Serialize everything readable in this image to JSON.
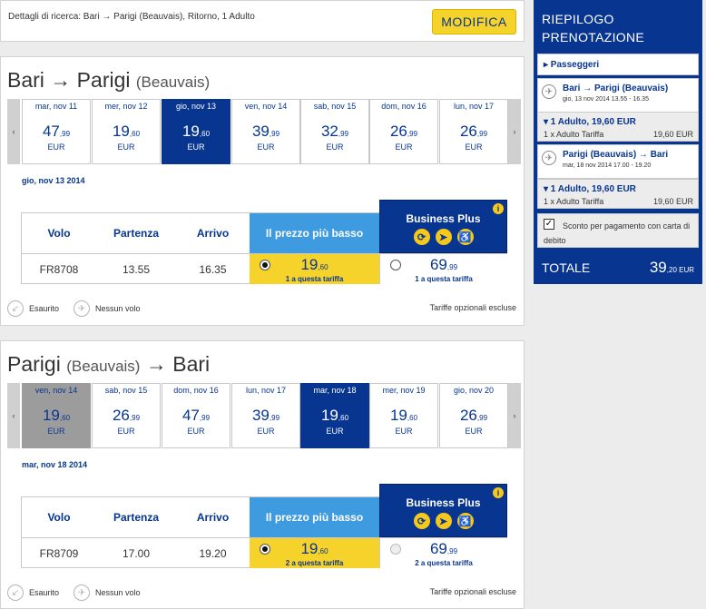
{
  "search": {
    "details": "Dettagli di ricerca: Bari → Parigi (Beauvais), Ritorno, 1 Adulto",
    "modify_label": "MODIFICA"
  },
  "legs": [
    {
      "title_main": "Bari → Parigi",
      "title_paren": "(Beauvais)",
      "days": [
        {
          "label": "mar, nov 11",
          "int": "47",
          "cents": ",99",
          "cur": "EUR",
          "state": "normal"
        },
        {
          "label": "mer, nov 12",
          "int": "19",
          "cents": ",60",
          "cur": "EUR",
          "state": "normal"
        },
        {
          "label": "gio, nov 13",
          "int": "19",
          "cents": ",60",
          "cur": "EUR",
          "state": "selected"
        },
        {
          "label": "ven, nov 14",
          "int": "39",
          "cents": ",99",
          "cur": "EUR",
          "state": "normal"
        },
        {
          "label": "sab, nov 15",
          "int": "32",
          "cents": ",99",
          "cur": "EUR",
          "state": "normal"
        },
        {
          "label": "dom, nov 16",
          "int": "26",
          "cents": ",99",
          "cur": "EUR",
          "state": "normal"
        },
        {
          "label": "lun, nov 17",
          "int": "26",
          "cents": ",99",
          "cur": "EUR",
          "state": "normal"
        }
      ],
      "date_heading": "gio, nov 13 2014",
      "headers": {
        "volo": "Volo",
        "partenza": "Partenza",
        "arrivo": "Arrivo",
        "lowest": "Il prezzo più basso",
        "business": "Business Plus"
      },
      "flight": {
        "number": "FR8708",
        "dep": "13.55",
        "arr": "16.35",
        "low_int": "19",
        "low_cents": ",60",
        "low_seats": "1 a questa tariffa",
        "biz_int": "69",
        "biz_cents": ",99",
        "biz_seats": "1 a questa tariffa",
        "low_selected": true
      }
    },
    {
      "title_main": "Parigi",
      "title_paren": "(Beauvais)",
      "title_tail": "→ Bari",
      "days": [
        {
          "label": "ven, nov 14",
          "int": "19",
          "cents": ",60",
          "cur": "EUR",
          "state": "grey"
        },
        {
          "label": "sab, nov 15",
          "int": "26",
          "cents": ",99",
          "cur": "EUR",
          "state": "normal"
        },
        {
          "label": "dom, nov 16",
          "int": "47",
          "cents": ",99",
          "cur": "EUR",
          "state": "normal"
        },
        {
          "label": "lun, nov 17",
          "int": "39",
          "cents": ",99",
          "cur": "EUR",
          "state": "normal"
        },
        {
          "label": "mar, nov 18",
          "int": "19",
          "cents": ",60",
          "cur": "EUR",
          "state": "selected"
        },
        {
          "label": "mer, nov 19",
          "int": "19",
          "cents": ",60",
          "cur": "EUR",
          "state": "normal"
        },
        {
          "label": "gio, nov 20",
          "int": "26",
          "cents": ",99",
          "cur": "EUR",
          "state": "normal"
        }
      ],
      "date_heading": "mar, nov 18 2014",
      "headers": {
        "volo": "Volo",
        "partenza": "Partenza",
        "arrivo": "Arrivo",
        "lowest": "Il prezzo più basso",
        "business": "Business Plus"
      },
      "flight": {
        "number": "FR8709",
        "dep": "17.00",
        "arr": "19.20",
        "low_int": "19",
        "low_cents": ",60",
        "low_seats": "2 a questa tariffa",
        "biz_int": "69",
        "biz_cents": ",99",
        "biz_seats": "2 a questa tariffa",
        "low_selected": true
      }
    }
  ],
  "legend": {
    "sold_out": "Esaurito",
    "no_flight": "Nessun volo",
    "optional": "Tariffe opzionali escluse"
  },
  "summary": {
    "title_line1": "RIEPILOGO",
    "title_line2": "PRENOTAZIONE",
    "passengers": "▸ Passeggeri",
    "out_route": "Bari → Parigi (Beauvais)",
    "out_date": "gio, 13 nov 2014 13.55 - 16.35",
    "out_fare_head": "▾ 1 Adulto, 19,60 EUR",
    "out_fare_line": "1 x Adulto Tariffa",
    "out_fare_amount": "19,60 EUR",
    "ret_route": "Parigi (Beauvais) → Bari",
    "ret_date": "mar, 18 nov 2014 17.00 - 19.20",
    "ret_fare_head": "▾ 1 Adulto, 19,60 EUR",
    "ret_fare_line": "1 x Adulto Tariffa",
    "ret_fare_amount": "19,60 EUR",
    "discount": "Sconto per pagamento con carta di debito",
    "total_label": "TOTALE",
    "total_int": "39",
    "total_cents": ",20 EUR"
  },
  "colors": {
    "brand": "#073590",
    "accent": "#f6d32b",
    "lowest_header": "#3f9be0"
  },
  "icons": [
    "plane-icon",
    "priority-icon",
    "fast-track-icon",
    "accessibility-icon",
    "info-icon",
    "sold-out-icon",
    "no-flight-icon"
  ]
}
